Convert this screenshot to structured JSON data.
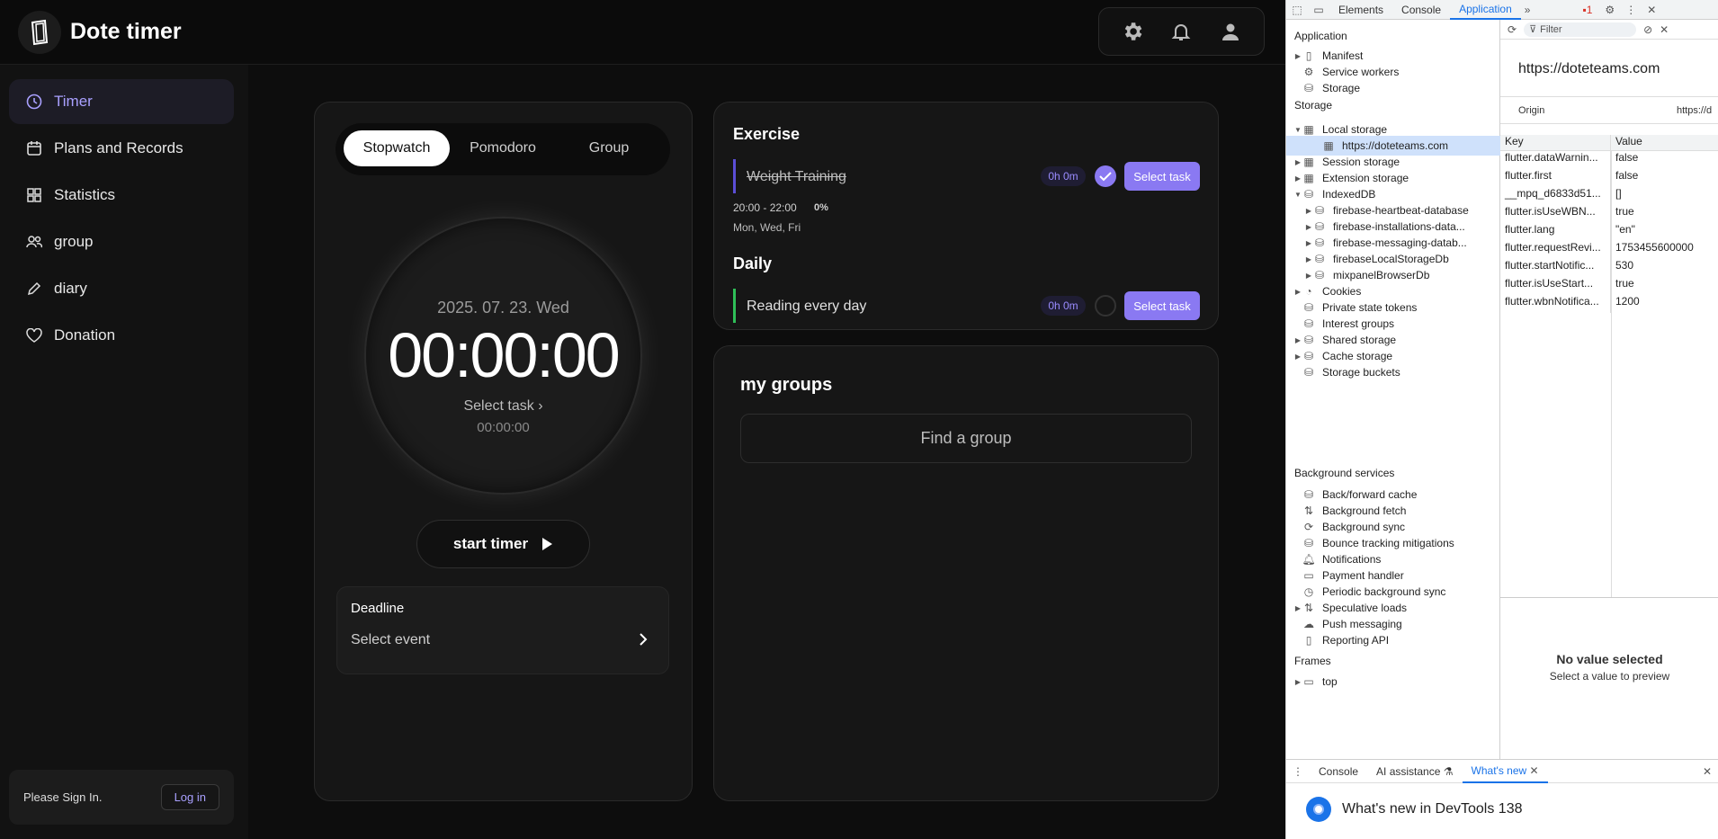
{
  "app": {
    "title": "Dote timer",
    "nav": [
      "Timer",
      "Plans and Records",
      "Statistics",
      "group",
      "diary",
      "Donation"
    ],
    "signin_text": "Please Sign In.",
    "login_label": "Log in"
  },
  "timer": {
    "tabs": [
      "Stopwatch",
      "Pomodoro",
      "Group"
    ],
    "date": "2025. 07. 23. Wed",
    "time": "00:00:00",
    "select_task": "Select task",
    "subtime": "00:00:00",
    "start_label": "start timer",
    "deadline_title": "Deadline",
    "deadline_value": "Select event"
  },
  "plans": {
    "exercise_title": "Exercise",
    "task1": {
      "name": "Weight Training",
      "duration": "0h 0m",
      "time": "20:00 - 22:00",
      "percent": "0%",
      "days": "Mon, Wed, Fri",
      "select": "Select task"
    },
    "daily_title": "Daily",
    "task2": {
      "name": "Reading every day",
      "duration": "0h 0m",
      "select": "Select task"
    }
  },
  "groups": {
    "title": "my groups",
    "find": "Find a group"
  },
  "devtools": {
    "tabs": [
      "Elements",
      "Console",
      "Application"
    ],
    "issues": "1",
    "filter_placeholder": "Filter",
    "origin_url": "https://doteteams.com",
    "origin_label": "Origin",
    "origin_value": "https://d",
    "tree": {
      "application_header": "Application",
      "manifest": "Manifest",
      "service_workers": "Service workers",
      "storage": "Storage",
      "storage_header": "Storage",
      "local_storage": "Local storage",
      "local_storage_item": "https://doteteams.com",
      "session_storage": "Session storage",
      "extension_storage": "Extension storage",
      "indexeddb": "IndexedDB",
      "db1": "firebase-heartbeat-database",
      "db2": "firebase-installations-data...",
      "db3": "firebase-messaging-datab...",
      "db4": "firebaseLocalStorageDb",
      "db5": "mixpanelBrowserDb",
      "cookies": "Cookies",
      "private_state": "Private state tokens",
      "interest_groups": "Interest groups",
      "shared_storage": "Shared storage",
      "cache_storage": "Cache storage",
      "storage_buckets": "Storage buckets",
      "bg_header": "Background services",
      "bfcache": "Back/forward cache",
      "bg_fetch": "Background fetch",
      "bg_sync": "Background sync",
      "bounce": "Bounce tracking mitigations",
      "notifications": "Notifications",
      "payment": "Payment handler",
      "periodic": "Periodic background sync",
      "speculative": "Speculative loads",
      "push": "Push messaging",
      "reporting": "Reporting API",
      "frames_header": "Frames",
      "top": "top"
    },
    "table_headers": {
      "key": "Key",
      "value": "Value"
    },
    "rows": [
      {
        "k": "flutter.dataWarnin...",
        "v": "false"
      },
      {
        "k": "flutter.first",
        "v": "false"
      },
      {
        "k": "__mpq_d6833d51...",
        "v": "[]"
      },
      {
        "k": "flutter.isUseWBN...",
        "v": "true"
      },
      {
        "k": "flutter.lang",
        "v": "\"en\""
      },
      {
        "k": "flutter.requestRevi...",
        "v": "1753455600000"
      },
      {
        "k": "flutter.startNotific...",
        "v": "530"
      },
      {
        "k": "flutter.isUseStart...",
        "v": "true"
      },
      {
        "k": "flutter.wbnNotifica...",
        "v": "1200"
      }
    ],
    "no_value": "No value selected",
    "no_value_sub": "Select a value to preview",
    "drawer_tabs": [
      "Console",
      "AI assistance",
      "What's new"
    ],
    "whats_new": "What's new in DevTools 138"
  }
}
